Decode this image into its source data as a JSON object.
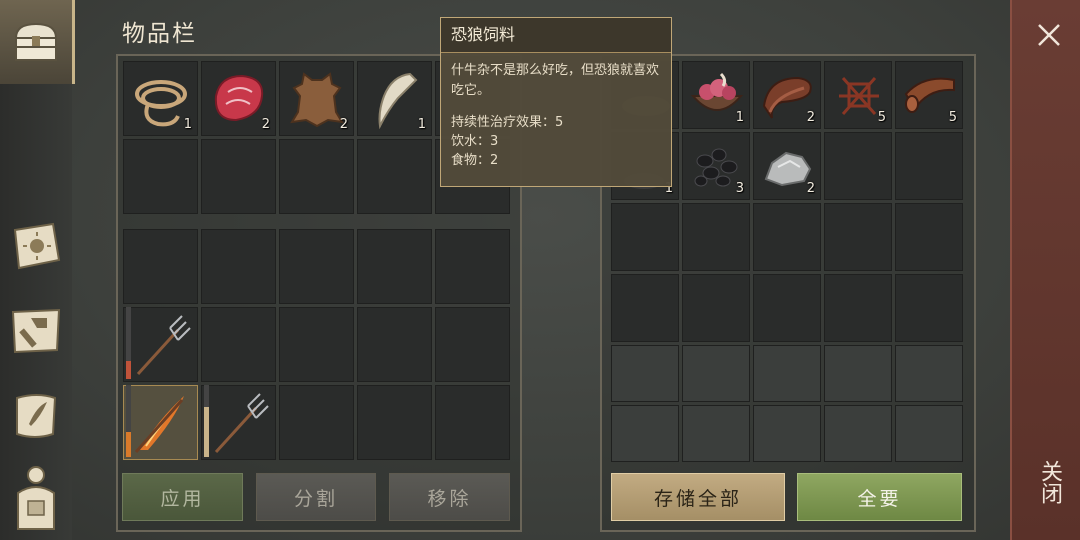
{
  "title": "物品栏",
  "tooltip": {
    "name": "恐狼饲料",
    "description": "什牛杂不是那么好吃，但恐狼就喜欢吃它。",
    "stats": [
      {
        "label": "持续性治疗效果",
        "value": "5"
      },
      {
        "label": "饮水",
        "value": "3"
      },
      {
        "label": "食物",
        "value": "2"
      }
    ]
  },
  "left_tabs": [
    {
      "name": "inventory-chest-icon",
      "active": true
    },
    {
      "name": "journal-sun-icon",
      "active": false
    },
    {
      "name": "crafting-hammer-icon",
      "active": false
    },
    {
      "name": "quest-scroll-icon",
      "active": false
    },
    {
      "name": "character-backpack-icon",
      "active": false
    }
  ],
  "inventory": {
    "items": [
      {
        "icon": "rope-icon",
        "count": "1"
      },
      {
        "icon": "raw-meat-icon",
        "count": "2"
      },
      {
        "icon": "animal-hide-icon",
        "count": "2"
      },
      {
        "icon": "fang-icon",
        "count": "1"
      }
    ]
  },
  "equipment": {
    "weapons": [
      {
        "icon": "pitchfork-icon",
        "durability": 0.25,
        "dur_color": "#c0533a"
      },
      {
        "icon": "flaming-spear-icon",
        "durability": 0.35,
        "dur_color": "#d97a2a"
      },
      {
        "icon": "pitchfork-icon",
        "durability": 0.7,
        "dur_color": "#c9b48a"
      }
    ]
  },
  "storage": {
    "items": [
      {
        "icon": "dire-wolf-feed-icon",
        "count": ""
      },
      {
        "icon": "guts-bowl-icon",
        "count": "1"
      },
      {
        "icon": "leather-strip-icon",
        "count": "2"
      },
      {
        "icon": "tendon-icon",
        "count": "5"
      },
      {
        "icon": "leather-roll-icon",
        "count": "5"
      },
      {
        "icon": "unknown-item-icon",
        "count": "1"
      },
      {
        "icon": "coal-icon",
        "count": "3"
      },
      {
        "icon": "stone-icon",
        "count": "2"
      }
    ]
  },
  "buttons": {
    "apply": "应用",
    "split": "分割",
    "remove": "移除",
    "store_all": "存储全部",
    "take_all": "全要",
    "close": "关闭"
  },
  "colors": {
    "accent_green": "#8fa761",
    "accent_tan": "#c2ab82",
    "close_red": "#6a3d34"
  }
}
